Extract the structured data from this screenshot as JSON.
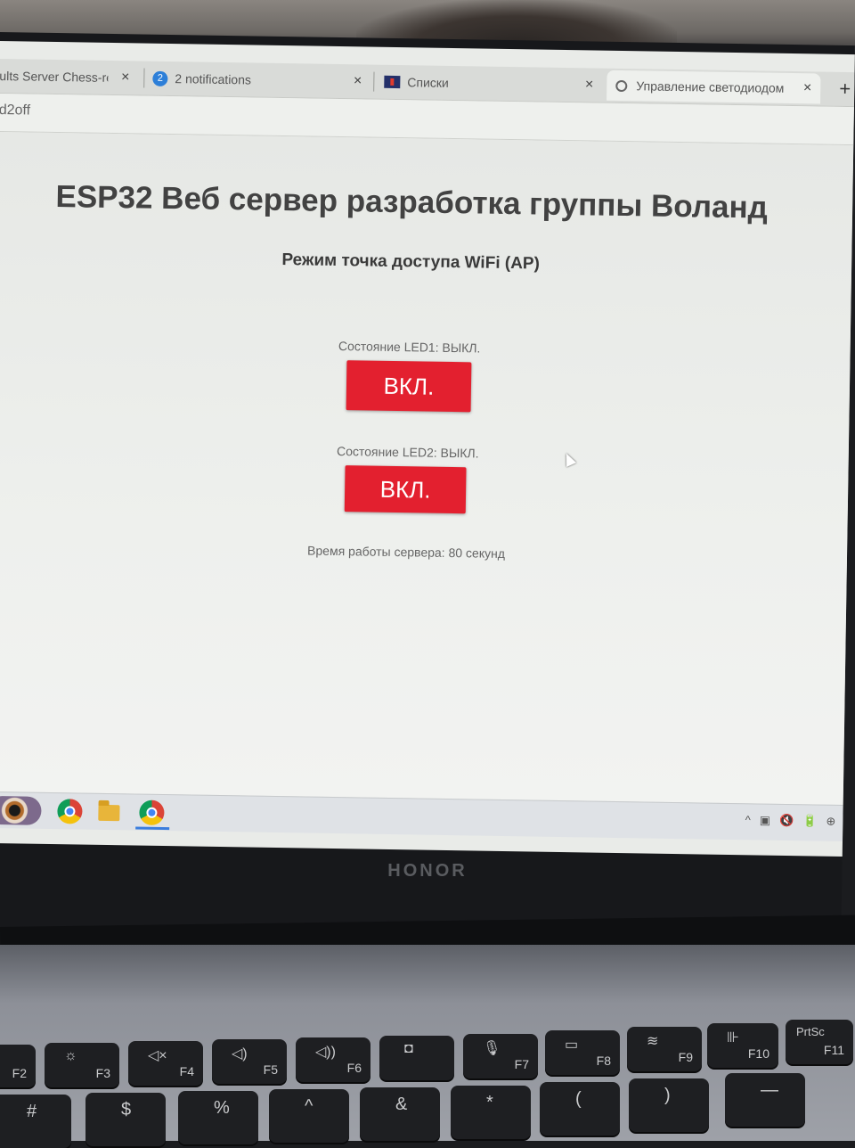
{
  "browser": {
    "tabs": [
      {
        "title": "ults Server Chess-resu",
        "close": "×"
      },
      {
        "badge": "2",
        "title": "2 notifications",
        "close": "×"
      },
      {
        "title": "Списки",
        "close": "×"
      },
      {
        "title": "Управление светодиодом",
        "close": "×",
        "active": true
      }
    ],
    "new_tab": "+",
    "url": "d2off"
  },
  "page": {
    "title": "ESP32 Веб сервер разработка группы Воланд",
    "subtitle": "Режим точка доступа WiFi (AP)",
    "led1": {
      "state": "Состояние LED1: ВЫКЛ.",
      "button": "ВКЛ."
    },
    "led2": {
      "state": "Состояние LED2: ВЫКЛ.",
      "button": "ВКЛ."
    },
    "uptime": "Время работы сервера: 80 секунд",
    "button_color": "#e3202f"
  },
  "taskbar": {
    "icons": [
      "eye-app-icon",
      "chrome-icon",
      "file-explorer-icon",
      "chrome-icon"
    ],
    "tray": [
      "^",
      "▣",
      "🔇",
      "🔋",
      "⊕"
    ]
  },
  "device": {
    "brand": "HONOR"
  },
  "keyboard": {
    "fkeys": [
      "F2",
      "F3",
      "F4",
      "F5",
      "F6",
      "F7",
      "F8",
      "F9",
      "F10",
      "F11"
    ],
    "prtsc": "PrtSc",
    "num_row": [
      "#",
      "$",
      "%",
      "^",
      "&",
      "*",
      "(",
      ")",
      "—"
    ]
  }
}
